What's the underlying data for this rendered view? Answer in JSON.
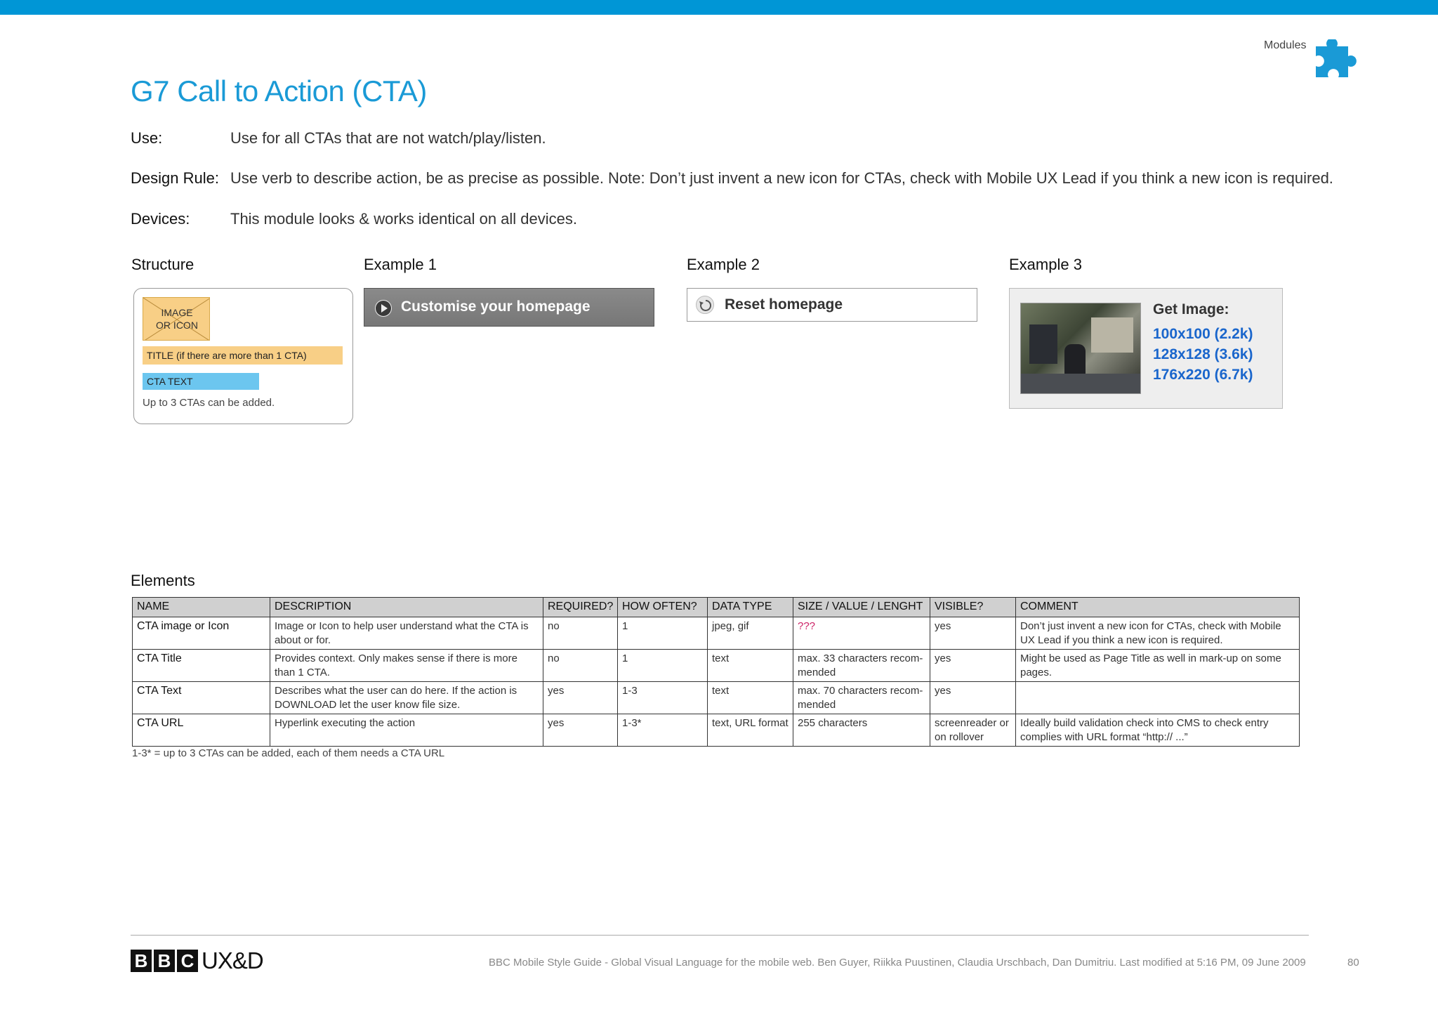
{
  "header": {
    "section_label": "Modules",
    "puzzle_color": "#1a9ad6",
    "bar_color": "#0096d6"
  },
  "page_title": "G7 Call to Action (CTA)",
  "rules": [
    {
      "label": "Use:",
      "text": "Use for all CTAs that are not watch/play/listen."
    },
    {
      "label": "Design Rule:",
      "text": "Use verb to describe action, be as precise as possible. Note: Don’t just invent a new icon for CTAs, check with Mobile UX Lead if you think a new icon is required."
    },
    {
      "label": "Devices:",
      "text": "This module looks & works identical on all devices."
    }
  ],
  "sections": {
    "structure": "Structure",
    "example1": "Example 1",
    "example2": "Example 2",
    "example3": "Example 3",
    "elements": "Elements"
  },
  "structure": {
    "image_line1": "IMAGE",
    "image_line2": "OR ICON",
    "title_text": "TITLE (if there are more than 1 CTA)",
    "cta_text": "CTA TEXT",
    "note": "Up to 3 CTAs can be added."
  },
  "example1": {
    "label": "Customise your homepage",
    "icon": "play-arrow-icon"
  },
  "example2": {
    "label": "Reset homepage",
    "icon": "reset-icon"
  },
  "example3": {
    "heading": "Get Image:",
    "links": [
      "100x100 (2.2k)",
      "128x128 (3.6k)",
      "176x220 (6.7k)"
    ]
  },
  "table": {
    "headers": [
      "NAME",
      "DESCRIPTION",
      "REQUIRED?",
      "HOW OFTEN?",
      "DATA TYPE",
      "SIZE / VALUE / LENGHT",
      "VISIBLE?",
      "COMMENT"
    ],
    "rows": [
      [
        "CTA image or Icon",
        "Image or Icon to help user understand what the CTA is about or for.",
        "no",
        "1",
        "jpeg, gif",
        "???",
        "yes",
        "Don’t just invent a new icon for CTAs, check with Mobile UX Lead if you think a new icon is required."
      ],
      [
        "CTA Title",
        "Provides context. Only makes sense if there is more than  1 CTA.",
        "no",
        "1",
        "text",
        "max. 33 characters recom-mended",
        "yes",
        "Might be used as Page Title as well in mark-up on some pages."
      ],
      [
        "CTA Text",
        "Describes what the user can do here. If the action is DOWNLOAD let the user know file size.",
        "yes",
        "1-3",
        "text",
        "max. 70 characters recom-mended",
        "yes",
        ""
      ],
      [
        "CTA URL",
        "Hyperlink executing the action",
        "yes",
        "1-3*",
        "text, URL format",
        "255 characters",
        "screenreader or on rollover",
        "Ideally build validation check into CMS to check entry complies with URL format “http:// ...”"
      ]
    ],
    "footnote": "1-3* = up to 3 CTAs can be added, each of them needs a CTA URL"
  },
  "footer": {
    "logo_letters": [
      "B",
      "B",
      "C"
    ],
    "logo_suffix": "UX&D",
    "text": "BBC Mobile Style Guide - Global Visual Language for the mobile web. Ben Guyer, Riikka Puustinen, Claudia Urschbach, Dan Dumitriu.  Last modified at 5:16 PM, 09 June 2009",
    "page_number": "80"
  }
}
